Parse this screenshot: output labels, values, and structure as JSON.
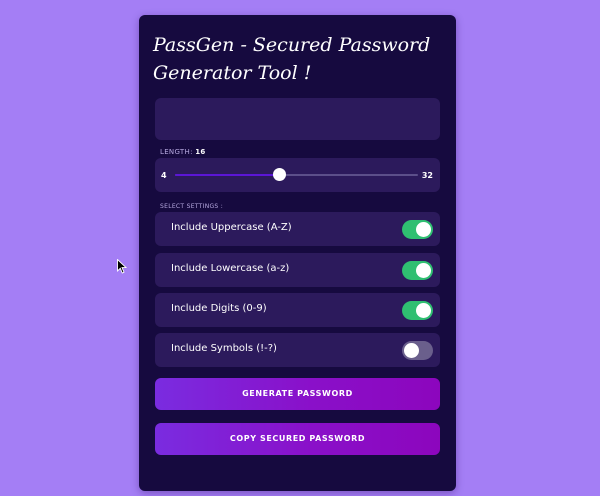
{
  "app": {
    "title": "PassGen - Secured Password Generator Tool !"
  },
  "password": {
    "value": ""
  },
  "length": {
    "label": "LENGTH:",
    "value": "16",
    "min": "4",
    "max": "32",
    "current": 16
  },
  "settings": {
    "label": "SELECT SETTINGS :",
    "items": [
      {
        "label": "Include Uppercase (A-Z)",
        "checked": true
      },
      {
        "label": "Include Lowercase (a-z)",
        "checked": true
      },
      {
        "label": "Include Digits (0-9)",
        "checked": true
      },
      {
        "label": "Include Symbols (!-?)",
        "checked": false
      }
    ]
  },
  "buttons": {
    "generate": "GENERATE PASSWORD",
    "copy": "COPY SECURED PASSWORD"
  },
  "colors": {
    "background": "#a47ef5",
    "card": "#160a3f",
    "panel": "#2c1a5c",
    "toggle_on": "#2fbf71",
    "toggle_off": "#6a5f8c",
    "button_gradient_start": "#7a2ce0",
    "button_gradient_end": "#8c06bd"
  },
  "icons": {
    "cursor": "mouse-pointer-icon"
  }
}
